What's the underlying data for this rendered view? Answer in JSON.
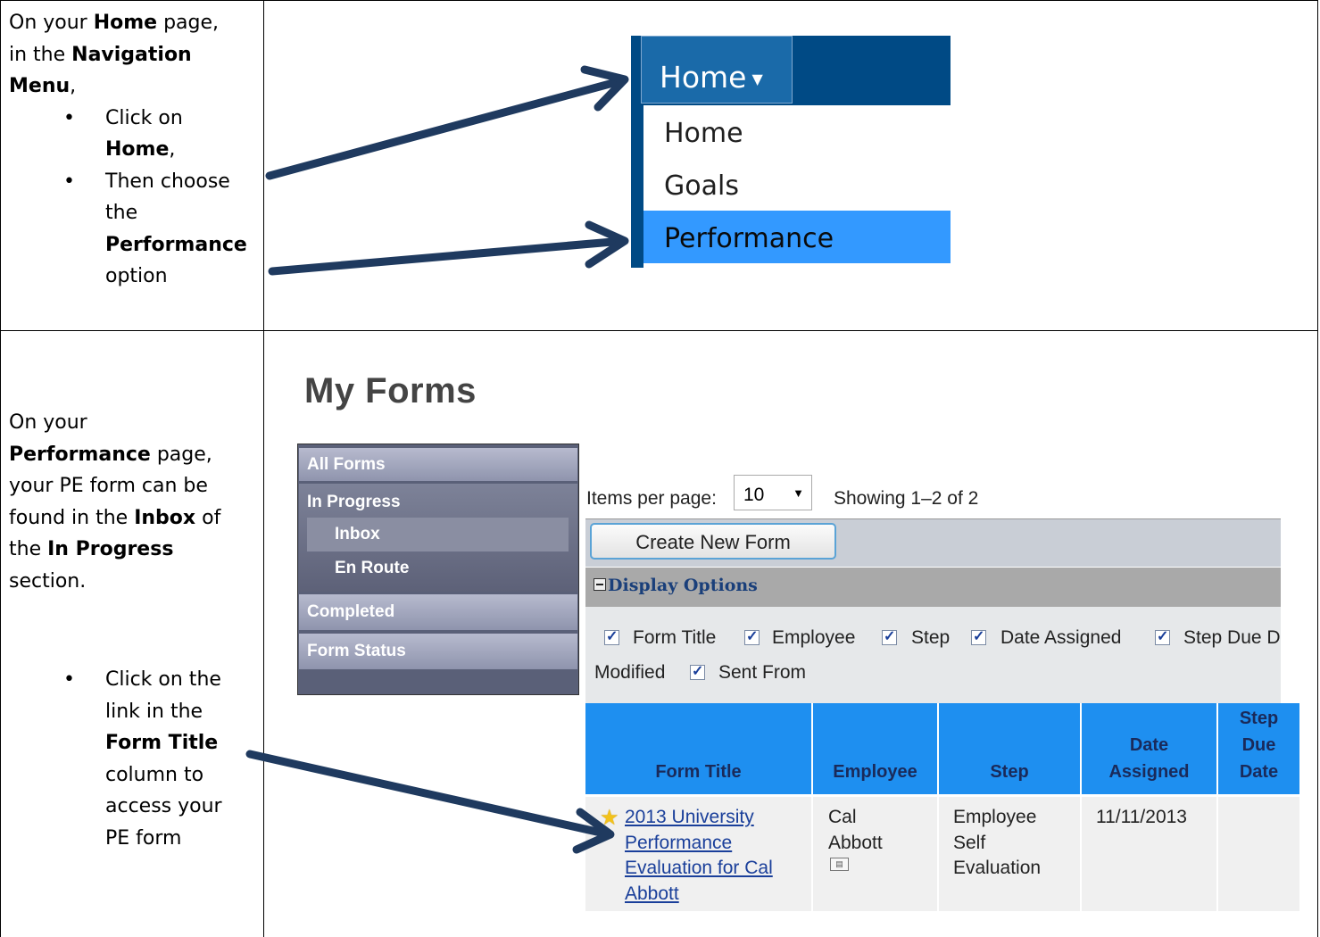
{
  "row1": {
    "instruction": {
      "intro_a": "On your ",
      "intro_b": "Home",
      "intro_c": " page,",
      "intro_d": "in the ",
      "intro_e": "Navigation",
      "intro_f": "Menu",
      "intro_g": ",",
      "bullet1_a": "Click on",
      "bullet1_b": "Home",
      "bullet1_c": ",",
      "bullet2_a": "Then choose",
      "bullet2_b": "the",
      "bullet2_c": "Performance",
      "bullet2_d": "option"
    },
    "nav": {
      "home_button": "Home",
      "items": [
        "Home",
        "Goals",
        "Performance"
      ],
      "selected": "Performance"
    }
  },
  "row2": {
    "instruction": {
      "p1": "On your",
      "p2": "Performance",
      "p3": " page,",
      "p4": "your PE form can be",
      "p5": "found in the ",
      "p6": "Inbox",
      "p7": " of",
      "p8": "the ",
      "p9": "In Progress",
      "p10": "section.",
      "b1": "Click on the",
      "b2": "link in the",
      "b3": "Form Title",
      "b4": "column to",
      "b5": "access your",
      "b6": "PE form"
    },
    "forms": {
      "title": "My Forms",
      "sidebar": {
        "all_forms": "All Forms",
        "in_progress": "In Progress",
        "inbox": "Inbox",
        "en_route": "En Route",
        "completed": "Completed",
        "form_status": "Form Status"
      },
      "items_per_page_label": "Items per page:",
      "items_per_page_value": "10",
      "showing": "Showing 1–2 of 2",
      "create_button": "Create New Form",
      "display_options": "Display Options",
      "options": [
        "Form Title",
        "Employee",
        "Step",
        "Date Assigned",
        "Step Due Dat",
        "Modified",
        "Sent From"
      ],
      "columns": {
        "form_title": "Form Title",
        "employee": "Employee",
        "step": "Step",
        "date_assigned_1": "Date",
        "date_assigned_2": "Assigned",
        "step_due_1": "Step",
        "step_due_2": "Due",
        "step_due_3": "Date"
      },
      "row": {
        "title_1": "2013 University",
        "title_2": "Performance",
        "title_3": "Evaluation for Cal",
        "title_4": "Abbott",
        "employee_1": "Cal",
        "employee_2": "Abbott",
        "step_1": "Employee",
        "step_2": "Self",
        "step_3": "Evaluation",
        "date_assigned": "11/11/2013"
      }
    }
  },
  "colors": {
    "nav_bar": "#004a85",
    "nav_selected": "#3399ff",
    "grid_header": "#1e8ff0",
    "arrow": "#1f3a5f"
  }
}
